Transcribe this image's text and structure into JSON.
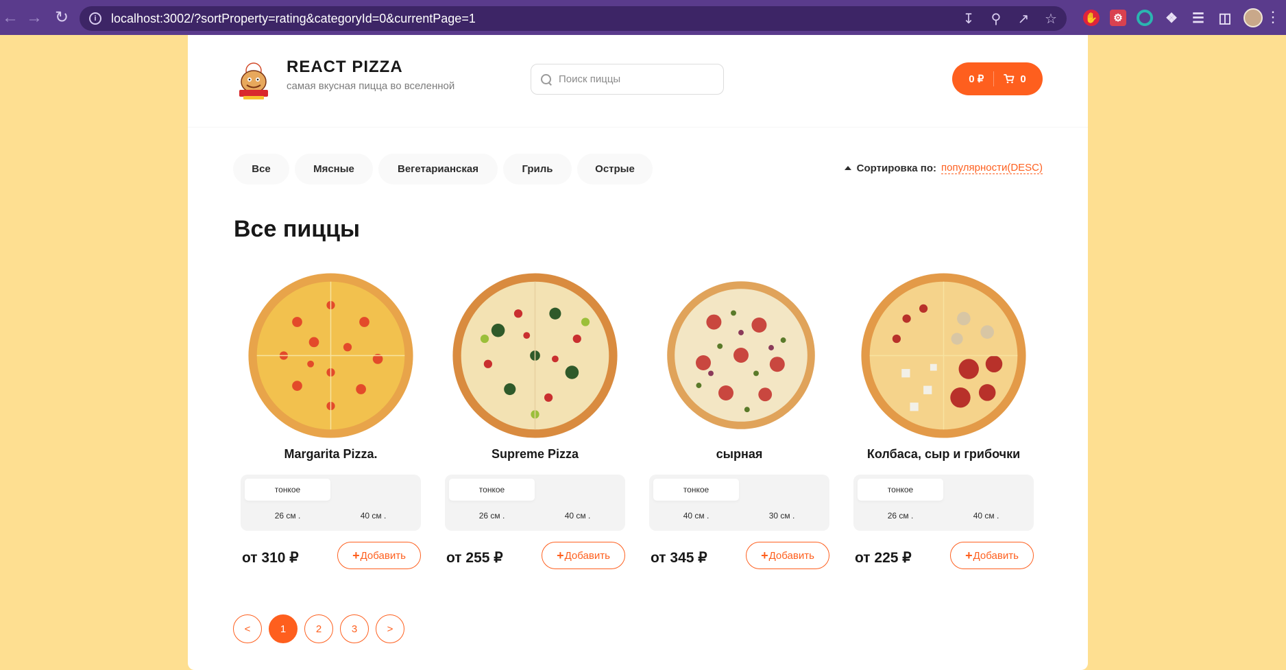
{
  "browser": {
    "url": "localhost:3002/?sortProperty=rating&categoryId=0&currentPage=1",
    "back_icon": "←",
    "forward_icon": "→",
    "reload_icon": "↻",
    "menu_icon": "⋮"
  },
  "header": {
    "logo_title": "REACT PIZZA",
    "logo_subtitle": "самая вкусная пицца во вселенной",
    "search_placeholder": "Поиск пиццы",
    "cart_total": "0 ₽",
    "cart_count": "0"
  },
  "categories": [
    {
      "label": "Все",
      "active": true
    },
    {
      "label": "Мясные",
      "active": false
    },
    {
      "label": "Вегетарианская",
      "active": false
    },
    {
      "label": "Гриль",
      "active": false
    },
    {
      "label": "Острые",
      "active": false
    }
  ],
  "sort": {
    "label": "Сортировка по:",
    "value": "популярности(DESC)"
  },
  "section_title": "Все пиццы",
  "pizzas": [
    {
      "name": "Margarita Pizza.",
      "type": "тонкое",
      "sizes": [
        "26 см .",
        "40 см ."
      ],
      "price": "от 310 ₽",
      "add_label": "Добавить",
      "colors": {
        "crust": "#e8a44a",
        "base": "#f2c14e",
        "topping": "#e34a2a",
        "accent": "#f7e3a0"
      }
    },
    {
      "name": "Supreme Pizza",
      "type": "тонкое",
      "sizes": [
        "26 см .",
        "40 см ."
      ],
      "price": "от 255 ₽",
      "add_label": "Добавить",
      "colors": {
        "crust": "#d98b3f",
        "base": "#f3e2b3",
        "topping": "#2f5a2a",
        "accent": "#c92f2f"
      }
    },
    {
      "name": "сырная",
      "type": "тонкое",
      "sizes": [
        "40 см .",
        "30 см ."
      ],
      "price": "от 345 ₽",
      "add_label": "Добавить",
      "colors": {
        "crust": "#e0a35a",
        "base": "#f3e6c4",
        "topping": "#c9473f",
        "accent": "#5a7a2a"
      }
    },
    {
      "name": "Колбаса, сыр и грибочки",
      "type": "тонкое",
      "sizes": [
        "26 см .",
        "40 см ."
      ],
      "price": "от 225 ₽",
      "add_label": "Добавить",
      "colors": {
        "crust": "#e39a48",
        "base": "#f5d38b",
        "topping": "#b8312a",
        "accent": "#f2f0e8"
      }
    }
  ],
  "pagination": {
    "prev": "<",
    "pages": [
      "1",
      "2",
      "3"
    ],
    "active": "1",
    "next": ">"
  },
  "theme": {
    "accent": "#fe5f1e",
    "page_background": "#fedf91",
    "browser_chrome": "#5a3b8c"
  }
}
